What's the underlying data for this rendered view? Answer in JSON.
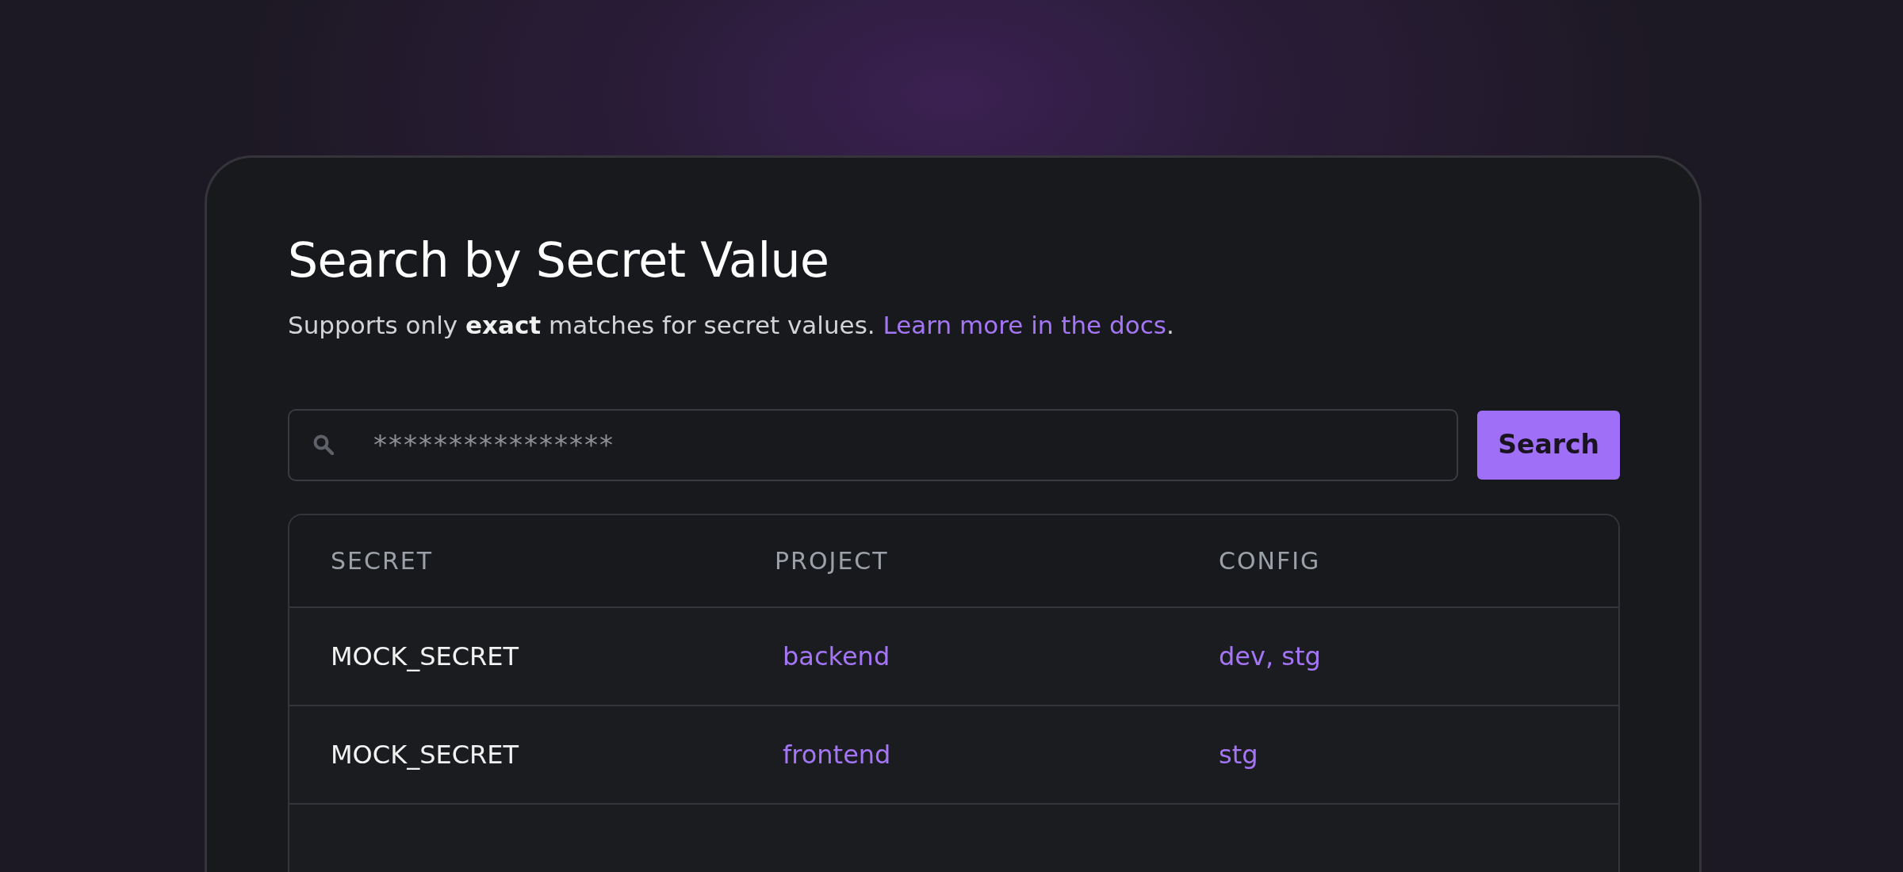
{
  "title": "Search by Secret Value",
  "subtitle": {
    "text": "Supports only **exact** matches for secret values. ",
    "link": "Learn more in the docs",
    "after": "."
  },
  "search": {
    "placeholder": "****************",
    "button": "Search"
  },
  "table": {
    "columns": [
      "SECRET",
      "PROJECT",
      "CONFIG"
    ],
    "rows": [
      {
        "secret": "MOCK_SECRET",
        "project": "backend",
        "config": "dev, stg"
      },
      {
        "secret": "MOCK_SECRET",
        "project": "frontend",
        "config": "stg"
      },
      {
        "secret": "",
        "project": "",
        "config": ""
      }
    ]
  }
}
